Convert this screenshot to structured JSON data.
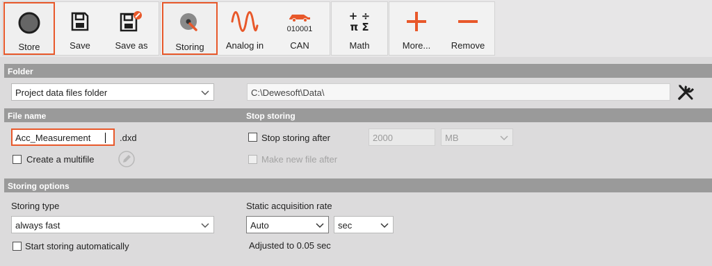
{
  "toolbar": {
    "buttons": [
      {
        "label": "Store",
        "icon": "record-circle-icon"
      },
      {
        "label": "Save",
        "icon": "floppy-disk-icon"
      },
      {
        "label": "Save as",
        "icon": "floppy-disk-edit-icon"
      },
      {
        "label": "Storing",
        "icon": "storing-disk-icon"
      },
      {
        "label": "Analog in",
        "icon": "sine-wave-icon"
      },
      {
        "label": "CAN",
        "icon": "car-can-icon",
        "caption": "010001"
      },
      {
        "label": "Math",
        "icon": "math-operators-icon"
      },
      {
        "label": "More...",
        "icon": "plus-icon"
      },
      {
        "label": "Remove",
        "icon": "minus-icon"
      }
    ],
    "math_symbols": {
      "a": "+",
      "b": "÷",
      "c": "π",
      "d": "Σ"
    }
  },
  "folder": {
    "section_title": "Folder",
    "folder_type": "Project data files folder",
    "path": "C:\\Dewesoft\\Data\\"
  },
  "file_name": {
    "section_title": "File name",
    "value": "Acc_Measurement",
    "extension": ".dxd",
    "multifile_label": "Create a multifile"
  },
  "stop_storing": {
    "section_title": "Stop storing",
    "stop_after_label": "Stop storing after",
    "stop_after_value": "2000",
    "unit": "MB",
    "new_file_label": "Make new file after"
  },
  "storing_options": {
    "section_title": "Storing options",
    "type_label": "Storing type",
    "type_value": "always fast",
    "auto_start_label": "Start storing automatically",
    "rate_label": "Static acquisition rate",
    "rate_value": "Auto",
    "rate_unit": "sec",
    "adjusted_text": "Adjusted to 0.05 sec"
  },
  "colors": {
    "accent": "#e8582a",
    "section_header": "#9a9a9a",
    "background": "#dcdbdc"
  }
}
